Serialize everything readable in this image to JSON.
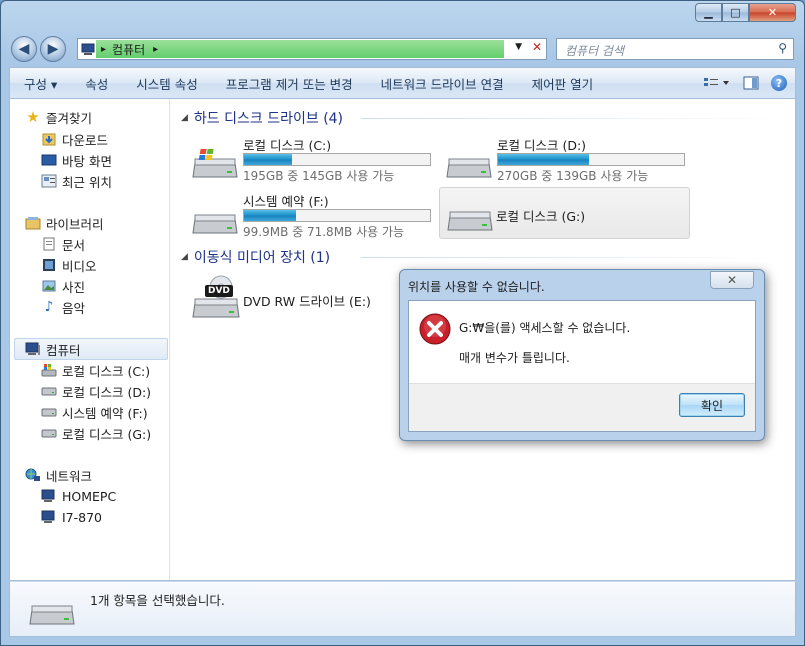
{
  "window": {
    "minimize": "▁",
    "maximize": "□",
    "close": "✕"
  },
  "nav": {
    "back": "◀",
    "forward": "▶",
    "address_path": "컴퓨터",
    "address_sep": "▸",
    "search_placeholder": "컴퓨터 검색"
  },
  "cmdbar": {
    "items": [
      "구성 ▾",
      "속성",
      "시스템 속성",
      "프로그램 제거 또는 변경",
      "네트워크 드라이브 연결",
      "제어판 열기"
    ],
    "help": "?"
  },
  "sidebar": {
    "favorites": "즐겨찾기",
    "fav_items": [
      "다운로드",
      "바탕 화면",
      "최근 위치"
    ],
    "libraries": "라이브러리",
    "lib_items": [
      "문서",
      "비디오",
      "사진",
      "음악"
    ],
    "computer": "컴퓨터",
    "comp_items": [
      "로컬 디스크 (C:)",
      "로컬 디스크 (D:)",
      "시스템 예약 (F:)",
      "로컬 디스크 (G:)"
    ],
    "network": "네트워크",
    "net_items": [
      "HOMEPC",
      "I7-870"
    ]
  },
  "main": {
    "hdd_header": "하드 디스크 드라이브 (4)",
    "removable_header": "이동식 미디어 장치 (1)",
    "drives": [
      {
        "name": "로컬 디스크 (C:)",
        "size": "195GB 중 145GB 사용 가능",
        "used": 0.26
      },
      {
        "name": "로컬 디스크 (D:)",
        "size": "270GB 중 139GB 사용 가능",
        "used": 0.49
      },
      {
        "name": "시스템 예약 (F:)",
        "size": "99.9MB 중 71.8MB 사용 가능",
        "used": 0.28
      },
      {
        "name": "로컬 디스크 (G:)",
        "size": "",
        "used": 0
      }
    ],
    "dvd_name": "DVD RW 드라이브 (E:)",
    "dvd_label": "DVD"
  },
  "status": {
    "text": "1개 항목을 선택했습니다."
  },
  "dialog": {
    "title": "위치를 사용할 수 없습니다.",
    "close": "✕",
    "message1": "G:₩을(를) 액세스할 수 없습니다.",
    "message2": "매개 변수가 틀립니다.",
    "ok": "확인"
  },
  "colors": {
    "address_bar": "#62cf6d",
    "progress": "#1b8fc9",
    "error": "#c8202a"
  }
}
